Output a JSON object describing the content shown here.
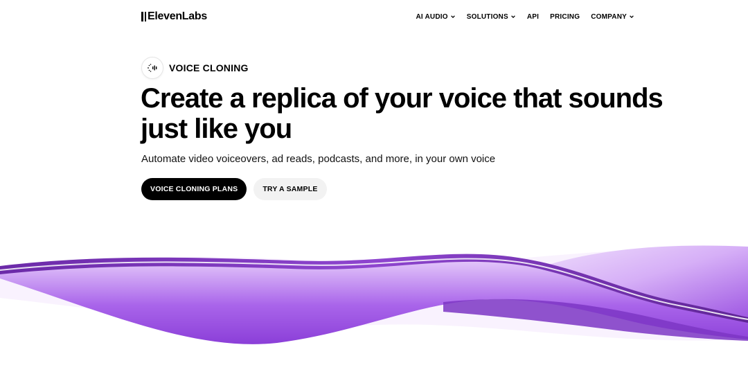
{
  "brand": {
    "name": "ElevenLabs"
  },
  "nav": {
    "items": [
      {
        "label": "AI AUDIO",
        "has_dropdown": true
      },
      {
        "label": "SOLUTIONS",
        "has_dropdown": true
      },
      {
        "label": "API",
        "has_dropdown": false
      },
      {
        "label": "PRICING",
        "has_dropdown": false
      },
      {
        "label": "COMPANY",
        "has_dropdown": true
      }
    ]
  },
  "hero": {
    "badge": {
      "icon": "voice-waves-icon",
      "label": "VOICE CLONING"
    },
    "headline_line1": "Create a replica of your voice that sounds",
    "headline_line2": "just like you",
    "subtitle": "Automate video voiceovers, ad reads, podcasts, and more, in your own voice",
    "primary_cta": "VOICE CLONING PLANS",
    "secondary_cta": "TRY A SAMPLE"
  },
  "colors": {
    "text": "#000000",
    "primary_button_bg": "#000000",
    "secondary_button_bg": "#f2f2f2",
    "wave_accent": "#9b4de0"
  }
}
